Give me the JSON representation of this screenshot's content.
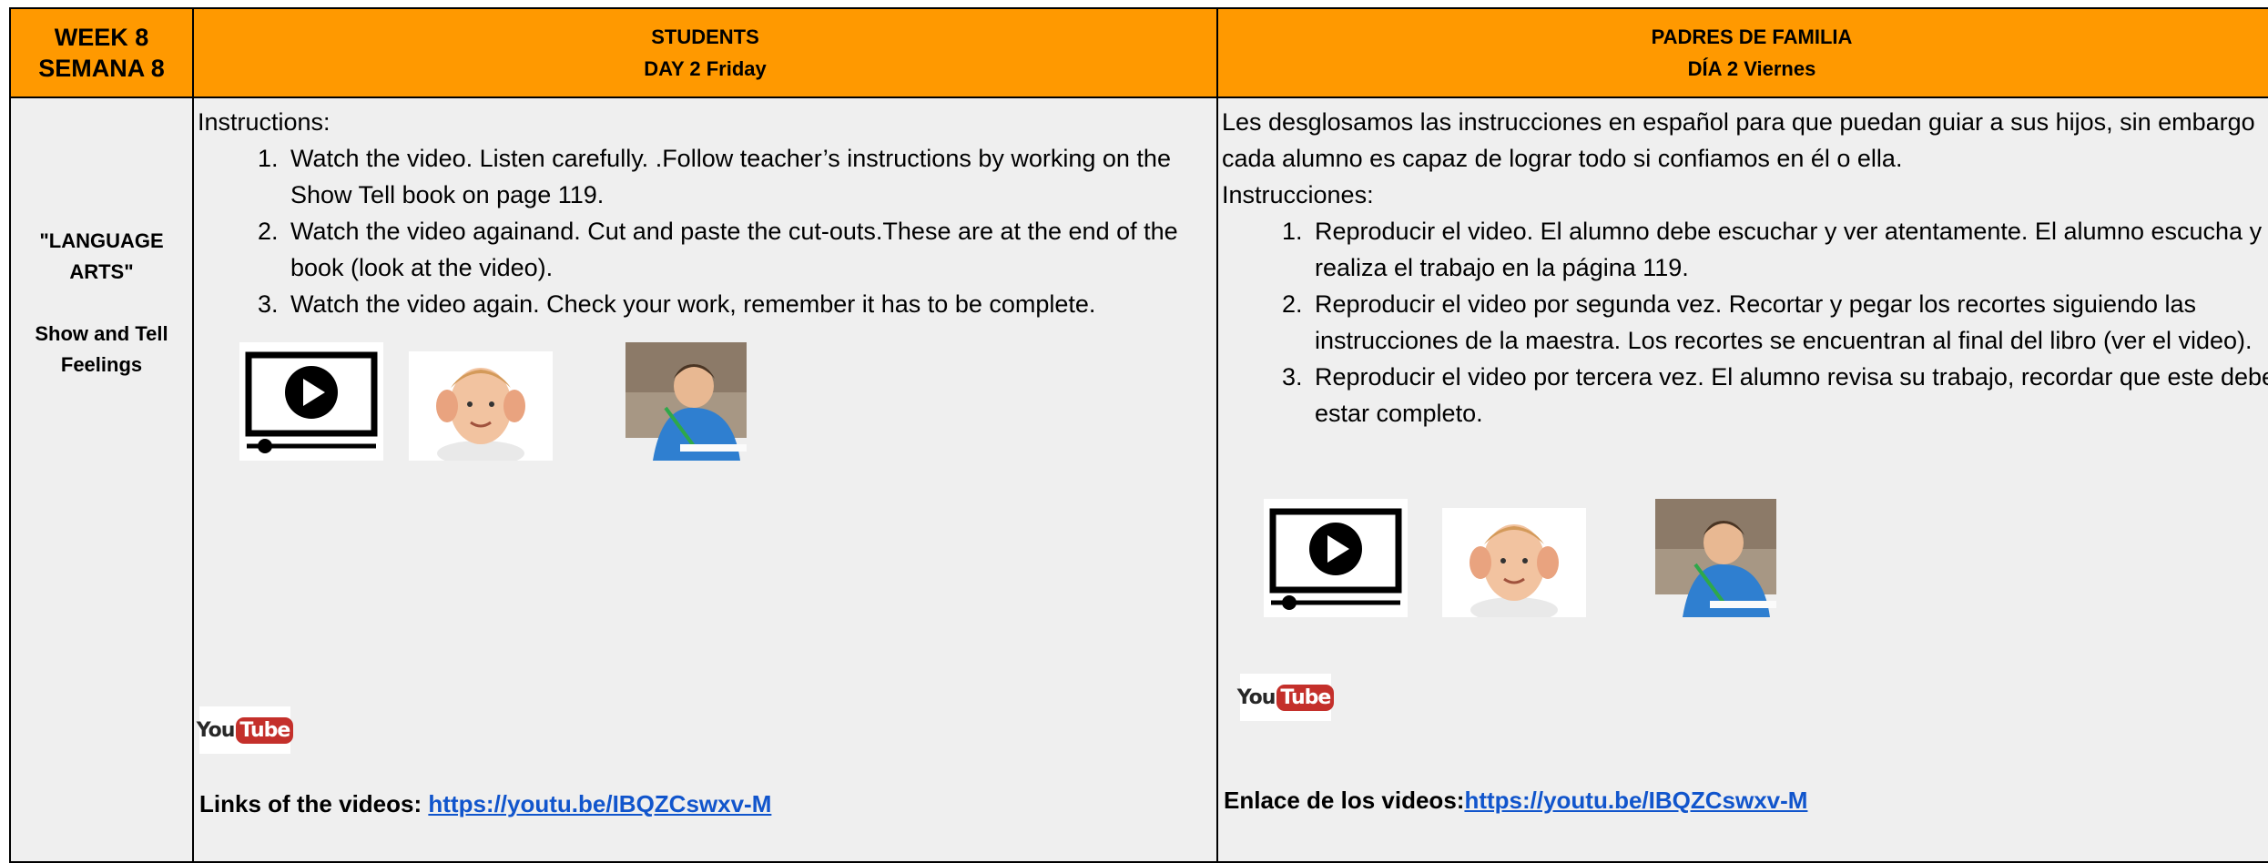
{
  "header": {
    "week_line1": "WEEK 8",
    "week_line2": "SEMANA 8",
    "students_title": "STUDENTS",
    "students_day": "DAY 2  Friday",
    "parents_title": "PADRES DE FAMILIA",
    "parents_day": "DÍA 2  Viernes"
  },
  "subject": {
    "line1": "\"LANGUAGE",
    "line2": "ARTS\"",
    "line3": "Show and Tell",
    "line4": "Feelings"
  },
  "students": {
    "intro": "Instructions:",
    "steps": [
      "Watch the video. Listen carefully. .Follow teacher’s instructions by working on the Show Tell book on page 119.",
      "Watch the video againand. Cut and paste the cut-outs.These are at the end of the book  (look at the video).",
      "Watch the video again.      Check your work, remember it has to be complete."
    ],
    "link_label": "Links of the videos: ",
    "link_url": "https://youtu.be/IBQZCswxv-M"
  },
  "parents": {
    "intro_line1": "Les desglosamos las instrucciones en español para que puedan guiar a sus hijos, sin embargo cada alumno es capaz de lograr todo si confiamos en él o ella.",
    "intro_line2": "Instrucciones:",
    "steps": [
      "Reproducir el video. El alumno debe escuchar y ver atentamente. El alumno escucha y realiza el trabajo en la página 119.",
      "Reproducir el video por segunda vez. Recortar y pegar los recortes siguiendo las instrucciones de la maestra. Los recortes se encuentran al final del libro (ver el video).",
      " Reproducir el video por tercera vez. El alumno revisa su trabajo, recordar que este debe estar completo."
    ],
    "link_label": "Enlace de los videos:",
    "link_url": "https://youtu.be/IBQZCswxv-M"
  },
  "icons": {
    "youtube_you": "You",
    "youtube_tube": "Tube"
  },
  "colors": {
    "header_bg": "#ff9900",
    "body_bg": "#efefef",
    "link": "#1155cc",
    "youtube_red": "#c4302b"
  }
}
